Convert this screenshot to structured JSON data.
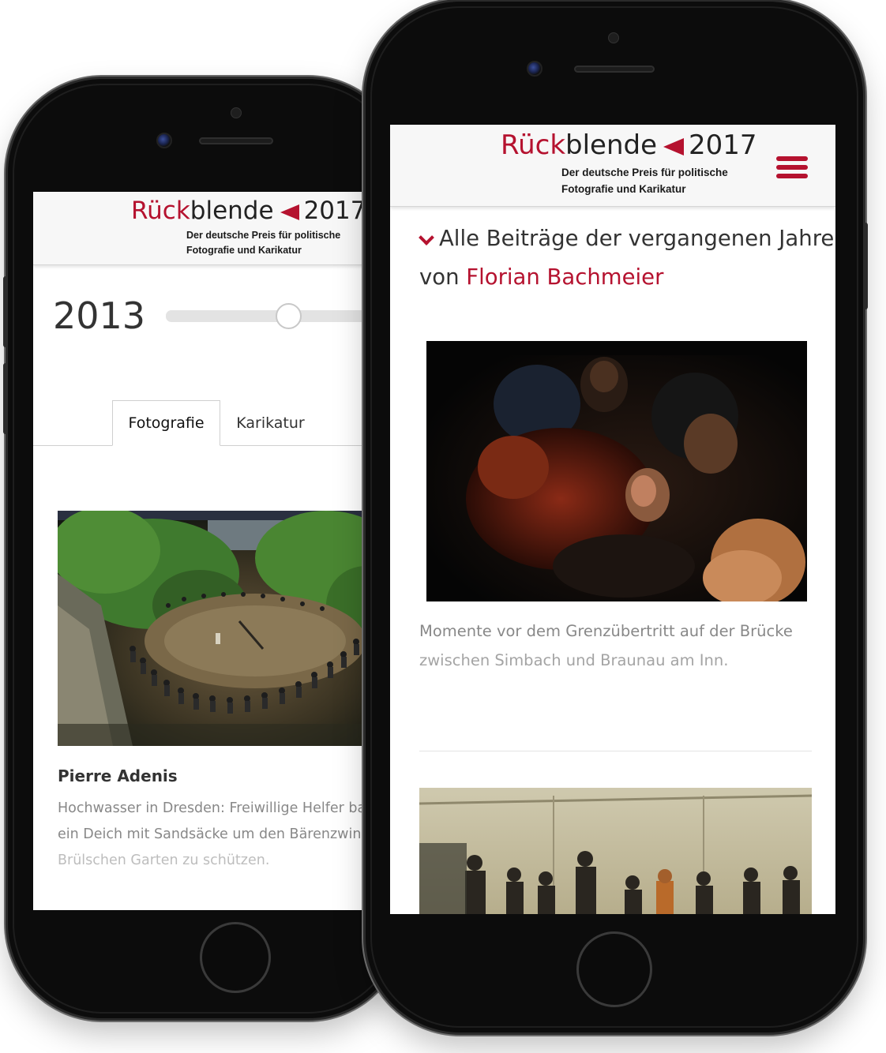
{
  "brand": {
    "logo_word_red": "Rück",
    "logo_word_dark": "blende",
    "logo_year": "2017",
    "tagline_line1": "Der deutsche Preis für politische",
    "tagline_line2": "Fotografie und Karikatur",
    "accent_color": "#b5122f"
  },
  "phone_left": {
    "year": "2013",
    "tabs": [
      {
        "label": "Fotografie",
        "active": true
      },
      {
        "label": "Karikatur",
        "active": false
      }
    ],
    "entry": {
      "author": "Pierre Adenis",
      "caption_line1": "Hochwasser in Dresden: Freiwillige Helfer ba",
      "caption_line2": "ein Deich mit Sandsäcke um den Bärenzwing",
      "caption_line3": "Brülschen Garten zu schützen."
    }
  },
  "phone_right": {
    "menu_icon": "hamburger-menu-icon",
    "heading_line1": "Alle Beiträge der vergangenen Jahre",
    "heading_prefix": "von",
    "heading_name": "Florian Bachmeier",
    "entry": {
      "caption_line1": "Momente vor dem Grenzübertritt auf der Brücke",
      "caption_line2": "zwischen Simbach und Braunau am Inn."
    }
  }
}
